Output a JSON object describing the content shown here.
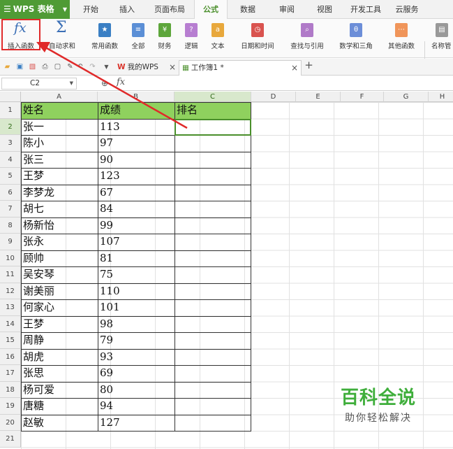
{
  "app": {
    "name": "WPS 表格"
  },
  "tabs": [
    "开始",
    "插入",
    "页面布局",
    "公式",
    "数据",
    "审阅",
    "视图",
    "开发工具",
    "云服务"
  ],
  "active_tab": "公式",
  "ribbon": {
    "insert_function": "插入函数",
    "autosum": "自动求和",
    "common": "常用函数",
    "all": "全部",
    "finance": "财务",
    "logic": "逻辑",
    "text": "文本",
    "datetime": "日期和时间",
    "lookup": "查找与引用",
    "math": "数学和三角",
    "other": "其他函数",
    "names": "名称管"
  },
  "doc_tabs": {
    "tab1": "我的WPS",
    "tab2": "工作簿1 *"
  },
  "formula_bar": {
    "name_box": "C2",
    "fx": "fx"
  },
  "columns": [
    "A",
    "B",
    "C",
    "D",
    "E",
    "F",
    "G",
    "H"
  ],
  "rows": [
    "1",
    "2",
    "3",
    "4",
    "5",
    "6",
    "7",
    "8",
    "9",
    "10",
    "11",
    "12",
    "13",
    "14",
    "15",
    "16",
    "17",
    "18",
    "19",
    "20",
    "21"
  ],
  "table": {
    "headers": [
      "姓名",
      "成绩",
      "排名"
    ],
    "data": [
      [
        "张一",
        "113"
      ],
      [
        "陈小",
        "97"
      ],
      [
        "张三",
        "90"
      ],
      [
        "王梦",
        "123"
      ],
      [
        "李梦龙",
        "67"
      ],
      [
        "胡七",
        "84"
      ],
      [
        "杨新怡",
        "99"
      ],
      [
        "张永",
        "107"
      ],
      [
        "顾帅",
        "81"
      ],
      [
        "吴安琴",
        "75"
      ],
      [
        "谢美丽",
        "110"
      ],
      [
        "何家心",
        "101"
      ],
      [
        "王梦",
        "98"
      ],
      [
        "周静",
        "79"
      ],
      [
        "胡虎",
        "93"
      ],
      [
        "张思",
        "69"
      ],
      [
        "杨可爱",
        "80"
      ],
      [
        "唐糖",
        "94"
      ],
      [
        "赵敏",
        "127"
      ]
    ]
  },
  "watermark": {
    "title": "百科全说",
    "subtitle": "助你轻松解决"
  }
}
